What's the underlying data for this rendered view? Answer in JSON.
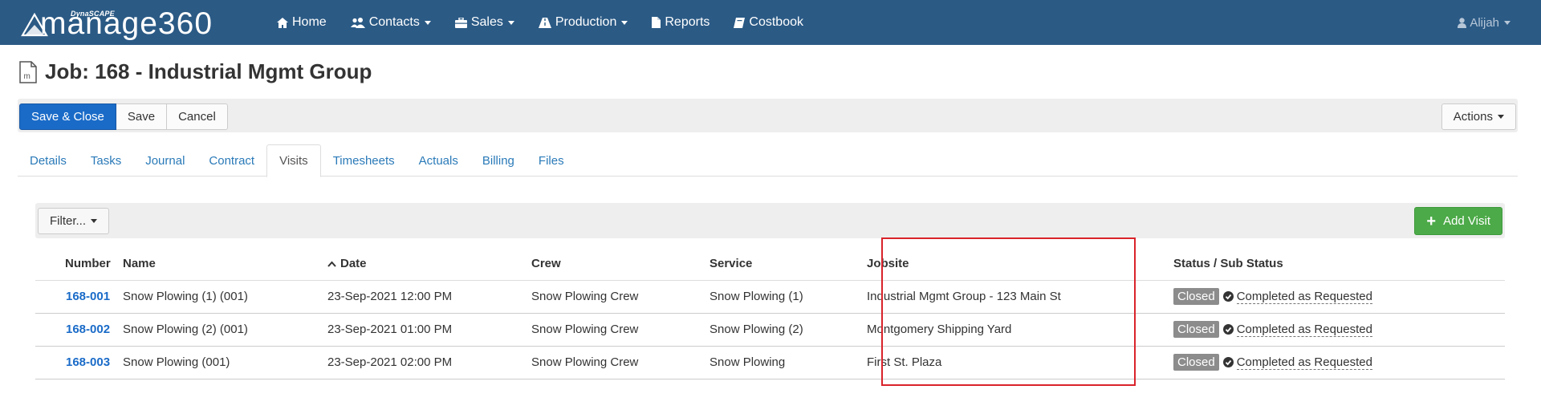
{
  "nav": {
    "brand_top": "DynaSCAPE",
    "brand_name": "manage360",
    "items": [
      {
        "label": "Home",
        "icon": "home-icon"
      },
      {
        "label": "Contacts",
        "icon": "users-icon",
        "dropdown": true
      },
      {
        "label": "Sales",
        "icon": "briefcase-icon",
        "dropdown": true
      },
      {
        "label": "Production",
        "icon": "road-icon",
        "dropdown": true
      },
      {
        "label": "Reports",
        "icon": "file-icon"
      },
      {
        "label": "Costbook",
        "icon": "book-icon"
      }
    ],
    "user": "Alijah"
  },
  "page": {
    "title": "Job: 168 - Industrial Mgmt Group",
    "icon_letter": "m"
  },
  "toolbar": {
    "save_close": "Save & Close",
    "save": "Save",
    "cancel": "Cancel",
    "actions": "Actions"
  },
  "tabs": [
    {
      "label": "Details",
      "active": false
    },
    {
      "label": "Tasks",
      "active": false
    },
    {
      "label": "Journal",
      "active": false
    },
    {
      "label": "Contract",
      "active": false
    },
    {
      "label": "Visits",
      "active": true
    },
    {
      "label": "Timesheets",
      "active": false
    },
    {
      "label": "Actuals",
      "active": false
    },
    {
      "label": "Billing",
      "active": false
    },
    {
      "label": "Files",
      "active": false
    }
  ],
  "visits": {
    "filter_label": "Filter...",
    "add_label": "Add Visit",
    "columns": {
      "number": "Number",
      "name": "Name",
      "date": "Date",
      "crew": "Crew",
      "service": "Service",
      "jobsite": "Jobsite",
      "status": "Status / Sub Status"
    },
    "rows": [
      {
        "number": "168-001",
        "name": "Snow Plowing (1) (001)",
        "date": "23-Sep-2021 12:00 PM",
        "crew": "Snow Plowing Crew",
        "service": "Snow Plowing (1)",
        "jobsite": "Industrial Mgmt Group - 123 Main St",
        "status": "Closed",
        "substatus": "Completed as Requested"
      },
      {
        "number": "168-002",
        "name": "Snow Plowing (2) (001)",
        "date": "23-Sep-2021 01:00 PM",
        "crew": "Snow Plowing Crew",
        "service": "Snow Plowing (2)",
        "jobsite": "Montgomery Shipping Yard",
        "status": "Closed",
        "substatus": "Completed as Requested"
      },
      {
        "number": "168-003",
        "name": "Snow Plowing (001)",
        "date": "23-Sep-2021 02:00 PM",
        "crew": "Snow Plowing Crew",
        "service": "Snow Plowing",
        "jobsite": "First St. Plaza",
        "status": "Closed",
        "substatus": "Completed as Requested"
      }
    ]
  },
  "colors": {
    "navbar": "#2b5a85",
    "primary": "#1a6bc8",
    "success": "#4caa48",
    "highlight": "#d9232b"
  }
}
